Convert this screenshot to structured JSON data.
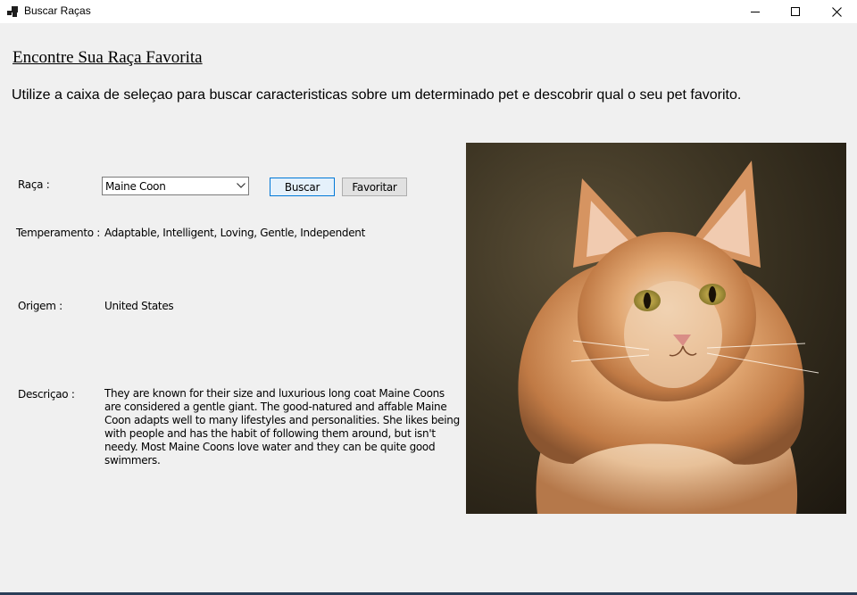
{
  "window": {
    "title": "Buscar Raças",
    "controls": [
      "minimize-icon",
      "maximize-icon",
      "close-icon"
    ]
  },
  "heading": "Encontre Sua Raça Favorita",
  "intro": "Utilize a caixa de seleçao para buscar caracteristicas sobre um determinado pet e descobrir qual o seu pet favorito.",
  "form": {
    "raca_label": "Raça :",
    "raca_selected": "Maine Coon",
    "buscar_label": "Buscar",
    "favoritar_label": "Favoritar",
    "temperamento_label": "Temperamento :",
    "temperamento_value": "Adaptable, Intelligent, Loving, Gentle, Independent",
    "origem_label": "Origem :",
    "origem_value": "United States",
    "descricao_label": "Descriçao :",
    "descricao_value": "They are known for their size and luxurious long coat Maine Coons are considered a gentle giant. The good-natured and affable Maine Coon adapts well to many lifestyles and personalities. She likes being with people and has the habit of following them around, but isn't needy. Most Maine Coons love water and they can be quite good swimmers."
  },
  "colors": {
    "window_bg": "#f0f0f0",
    "titlebar_bg": "#ffffff",
    "accent_border": "#0078d7",
    "buscar_bg": "#e5f1fb"
  }
}
